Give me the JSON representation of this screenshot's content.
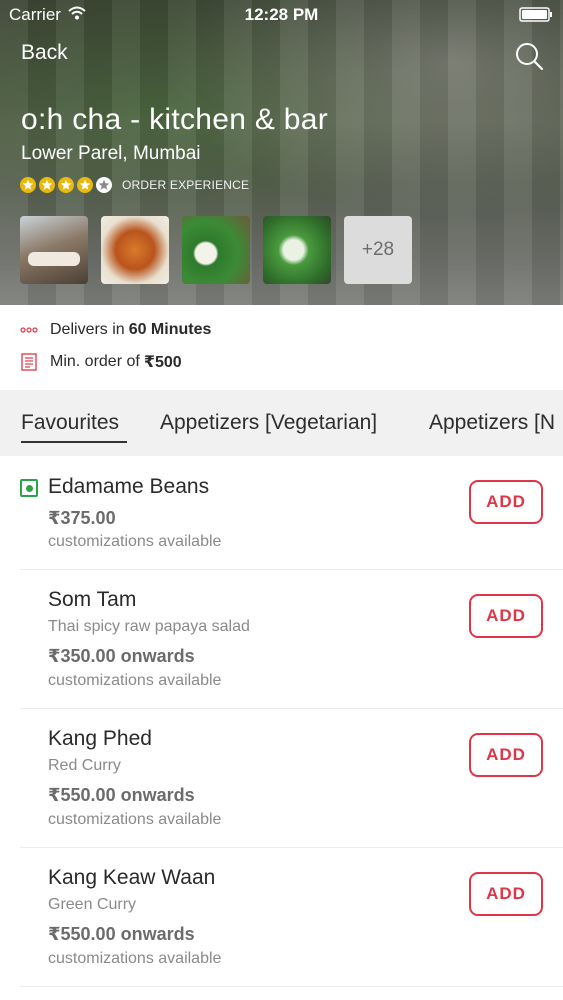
{
  "status_bar": {
    "carrier": "Carrier",
    "time": "12:28 PM"
  },
  "header": {
    "back_label": "Back",
    "title": "o:h cha - kitchen & bar",
    "location": "Lower Parel, Mumbai",
    "rating_stars": 4,
    "rating_max": 5,
    "rating_label": "ORDER EXPERIENCE",
    "more_photos_label": "+28",
    "star_color": "#e8b90f"
  },
  "delivery": {
    "delivers_prefix": "Delivers in",
    "delivers_time": "60 Minutes",
    "min_order_prefix": "Min. order of",
    "min_order_value": "₹500"
  },
  "tabs": [
    {
      "label": "Favourites",
      "active": true
    },
    {
      "label": "Appetizers [Vegetarian]",
      "active": false
    },
    {
      "label": "Appetizers [N",
      "active": false
    }
  ],
  "menu": {
    "add_label": "ADD",
    "accent_color": "#e03546",
    "veg_color": "#2aa34a",
    "items": [
      {
        "name": "Edamame Beans",
        "description": "",
        "price": "₹375.00",
        "customizations": "customizations available",
        "veg": true
      },
      {
        "name": "Som Tam",
        "description": "Thai spicy raw papaya salad",
        "price": "₹350.00 onwards",
        "customizations": "customizations available",
        "veg": false
      },
      {
        "name": "Kang Phed",
        "description": "Red Curry",
        "price": "₹550.00 onwards",
        "customizations": "customizations available",
        "veg": false
      },
      {
        "name": "Kang Keaw Waan",
        "description": "Green Curry",
        "price": "₹550.00 onwards",
        "customizations": "customizations available",
        "veg": false
      }
    ]
  }
}
